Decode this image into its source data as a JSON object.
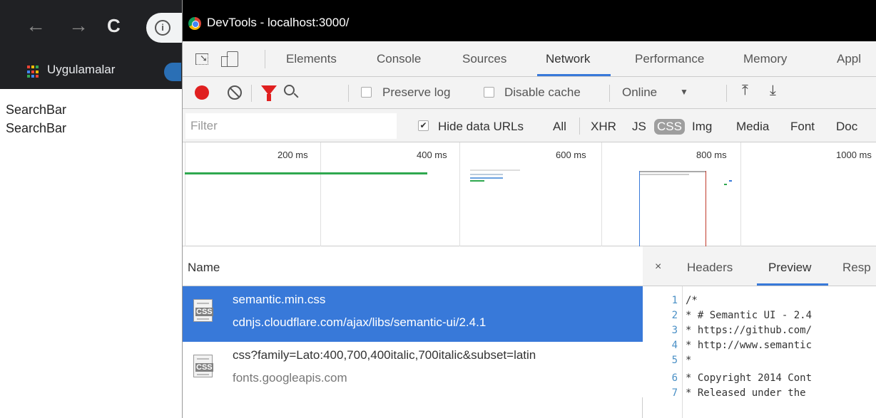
{
  "browser": {
    "bookmarks_label": "Uygulamalar",
    "page_lines": [
      "SearchBar",
      "SearchBar"
    ]
  },
  "devtools": {
    "title": "DevTools - localhost:3000/",
    "tabs": [
      "Elements",
      "Console",
      "Sources",
      "Network",
      "Performance",
      "Memory",
      "Appl"
    ],
    "active_tab": "Network",
    "toolbar": {
      "preserve_log": "Preserve log",
      "disable_cache": "Disable cache",
      "throttle": "Online"
    },
    "filterbar": {
      "placeholder": "Filter",
      "hide_data_urls": "Hide data URLs",
      "types": [
        "All",
        "XHR",
        "JS",
        "CSS",
        "Img",
        "Media",
        "Font",
        "Doc"
      ],
      "active_type": "CSS"
    },
    "timeline": {
      "ticks": [
        "200 ms",
        "400 ms",
        "600 ms",
        "800 ms",
        "1000 ms"
      ]
    },
    "requests": {
      "header": "Name",
      "rows": [
        {
          "name": "semantic.min.css",
          "domain": "cdnjs.cloudflare.com/ajax/libs/semantic-ui/2.4.1",
          "icon": "css-file-icon",
          "selected": true
        },
        {
          "name": "css?family=Lato:400,700,400italic,700italic&subset=latin",
          "domain": "fonts.googleapis.com",
          "icon": "css-file-icon",
          "selected": false
        }
      ]
    },
    "detail": {
      "close": "×",
      "tabs": [
        "Headers",
        "Preview",
        "Resp"
      ],
      "active_tab": "Preview",
      "code_lines": [
        {
          "n": "1",
          "text": "/*"
        },
        {
          "n": "2",
          "text": " * # Semantic UI - 2.4"
        },
        {
          "n": "3",
          "text": " * https://github.com/"
        },
        {
          "n": "4",
          "text": " * http://www.semantic"
        },
        {
          "n": "5",
          "text": " *"
        },
        {
          "n": "6",
          "text": " * Copyright 2014 Cont"
        },
        {
          "n": "7",
          "text": " * Released under the"
        }
      ]
    }
  },
  "colors": {
    "accent": "#3879d9",
    "record": "#e02020",
    "titlebar": "#000000"
  }
}
